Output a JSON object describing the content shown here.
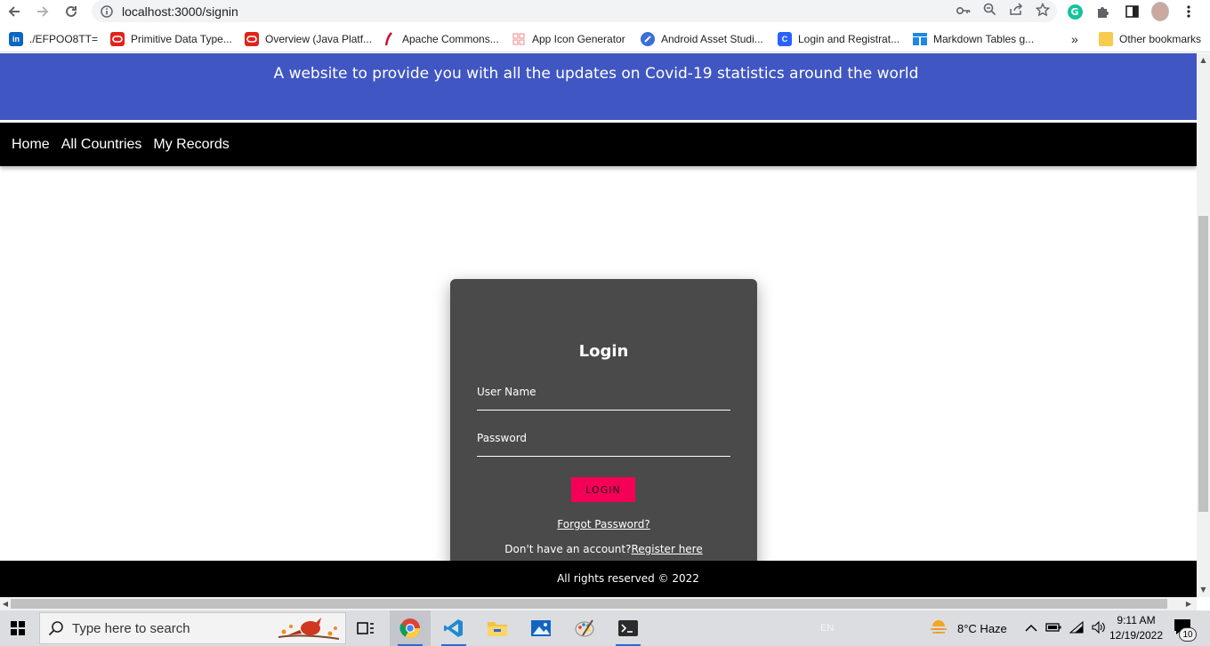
{
  "browser": {
    "url": "localhost:3000/signin",
    "bookmarks": [
      {
        "label": "./EFPOO8TT="
      },
      {
        "label": "Primitive Data Type..."
      },
      {
        "label": "Overview (Java Platf..."
      },
      {
        "label": "Apache Commons..."
      },
      {
        "label": "App Icon Generator"
      },
      {
        "label": "Android Asset Studi..."
      },
      {
        "label": "Login and Registrat..."
      },
      {
        "label": "Markdown Tables g..."
      }
    ],
    "overflow_label": "»",
    "other_bookmarks": "Other bookmarks"
  },
  "site": {
    "tagline": "A website to provide you with all the updates on Covid-19 statistics around the world",
    "nav": [
      {
        "label": "Home"
      },
      {
        "label": "All Countries"
      },
      {
        "label": "My Records"
      }
    ]
  },
  "login": {
    "title": "Login",
    "username_label": "User Name",
    "password_label": "Password",
    "button_label": "LOGIN",
    "forgot_label": "Forgot Password?",
    "no_account_text": "Don't have an account?",
    "register_label": "Register here"
  },
  "footer": {
    "text": "All rights reserved © 2022"
  },
  "taskbar": {
    "search_placeholder": "Type here to search",
    "language": "EN",
    "weather": "8°C  Haze",
    "time": "9:11 AM",
    "date": "12/19/2022",
    "notification_count": "10"
  },
  "colors": {
    "banner": "#4056c2",
    "card": "#4a4a4a",
    "login_button": "#f50057"
  }
}
